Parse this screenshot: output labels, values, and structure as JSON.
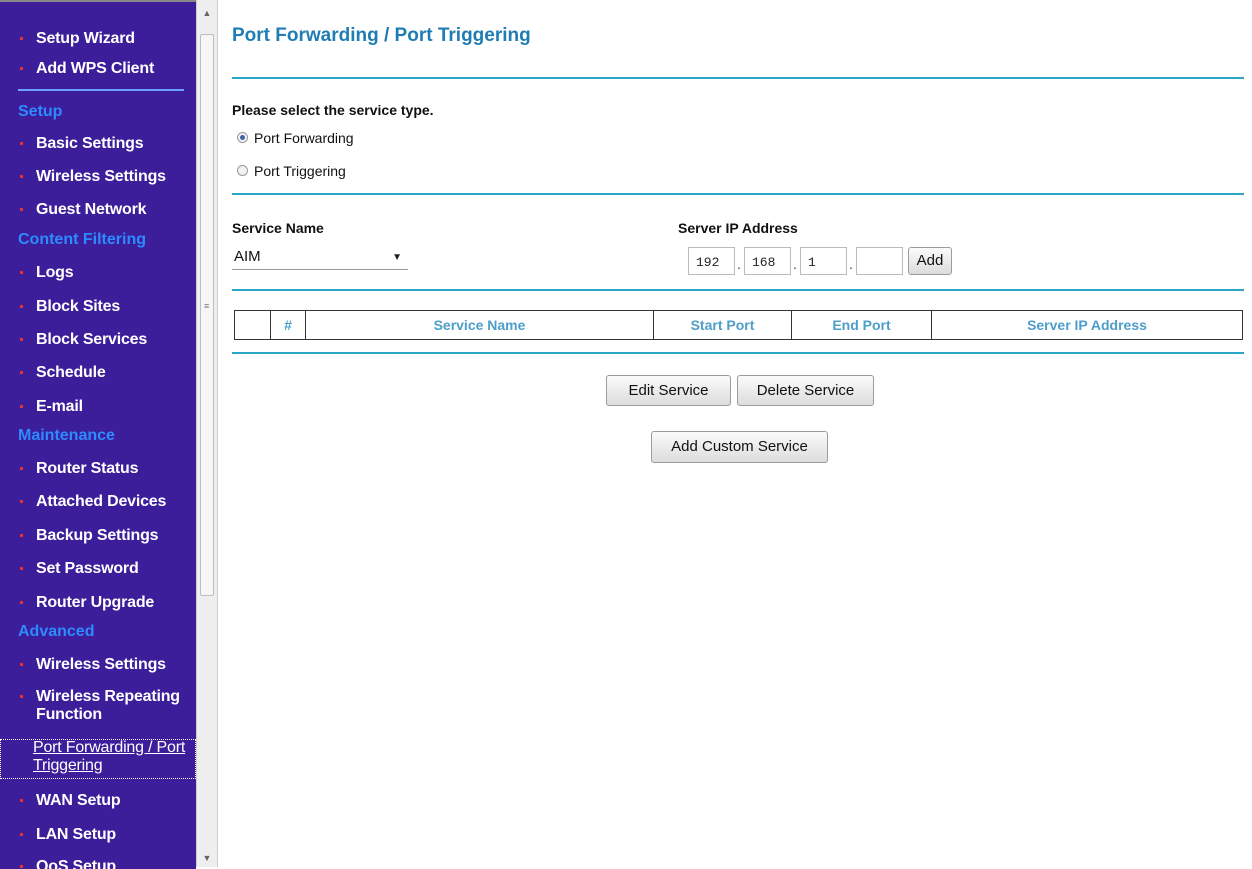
{
  "sidebar": {
    "top_items": [
      {
        "label": "Setup Wizard"
      },
      {
        "label": "Add WPS Client"
      }
    ],
    "sections": [
      {
        "header": "Setup",
        "items": [
          "Basic Settings",
          "Wireless Settings",
          "Guest Network"
        ]
      },
      {
        "header": "Content Filtering",
        "items": [
          "Logs",
          "Block Sites",
          "Block Services",
          "Schedule",
          "E-mail"
        ]
      },
      {
        "header": "Maintenance",
        "items": [
          "Router Status",
          "Attached Devices",
          "Backup Settings",
          "Set Password",
          "Router Upgrade"
        ]
      },
      {
        "header": "Advanced",
        "items": [
          "Wireless Settings",
          "Wireless Repeating Function",
          "Port Forwarding / Port Triggering",
          "WAN Setup",
          "LAN Setup",
          "QoS Setup"
        ]
      }
    ],
    "active_item": "Port Forwarding / Port Triggering",
    "colors": {
      "background": "#3c1d9a",
      "section_header": "#2d8bff",
      "bullet": "#e8322a"
    }
  },
  "main": {
    "title": "Port Forwarding / Port Triggering",
    "service_type_prompt": "Please select the service type.",
    "service_types": [
      {
        "label": "Port Forwarding",
        "checked": true
      },
      {
        "label": "Port Triggering",
        "checked": false
      }
    ],
    "service_name_label": "Service Name",
    "service_name_value": "AIM",
    "server_ip_label": "Server IP Address",
    "server_ip": [
      "192",
      "168",
      "1",
      ""
    ],
    "add_button": "Add",
    "table": {
      "columns": [
        "",
        "#",
        "Service Name",
        "Start Port",
        "End Port",
        "Server IP Address"
      ],
      "rows": []
    },
    "edit_button": "Edit Service",
    "delete_button": "Delete Service",
    "add_custom_button": "Add Custom Service",
    "colors": {
      "title": "#1f7db3",
      "rule": "#2aa6c8",
      "table_header": "#4d9ec9"
    }
  }
}
